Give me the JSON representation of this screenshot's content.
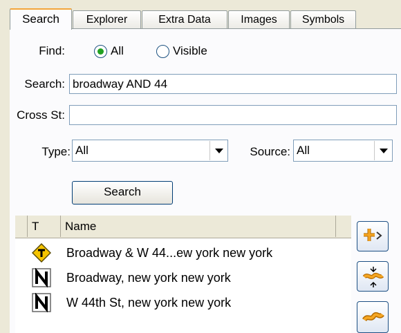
{
  "tabs": [
    {
      "label": "Search",
      "active": true
    },
    {
      "label": "Explorer",
      "active": false
    },
    {
      "label": "Extra Data",
      "active": false
    },
    {
      "label": "Images",
      "active": false
    },
    {
      "label": "Symbols",
      "active": false
    }
  ],
  "find": {
    "label": "Find:",
    "options": [
      "All",
      "Visible"
    ],
    "selected": "All"
  },
  "search": {
    "label": "Search:",
    "value": "broadway AND 44"
  },
  "cross_street": {
    "label": "Cross St:",
    "value": ""
  },
  "type": {
    "label": "Type:",
    "value": "All"
  },
  "source": {
    "label": "Source:",
    "value": "All"
  },
  "search_button": "Search",
  "results": {
    "columns": [
      "T",
      "Name"
    ],
    "rows": [
      {
        "icon": "intersection-diamond-icon",
        "name": "Broadway & W 44...ew york new york"
      },
      {
        "icon": "street-n-icon",
        "name": "Broadway,  new york new york"
      },
      {
        "icon": "street-n-icon",
        "name": "W 44th St,  new york new york"
      }
    ]
  },
  "side_buttons": [
    "add-to-route-icon",
    "zoom-to-icon",
    "show-on-map-icon"
  ],
  "colors": {
    "tab_active_accent": "#f3a53a",
    "radio_dot": "#21a121",
    "diamond": "#f5c400",
    "border": "#7f9db9"
  }
}
